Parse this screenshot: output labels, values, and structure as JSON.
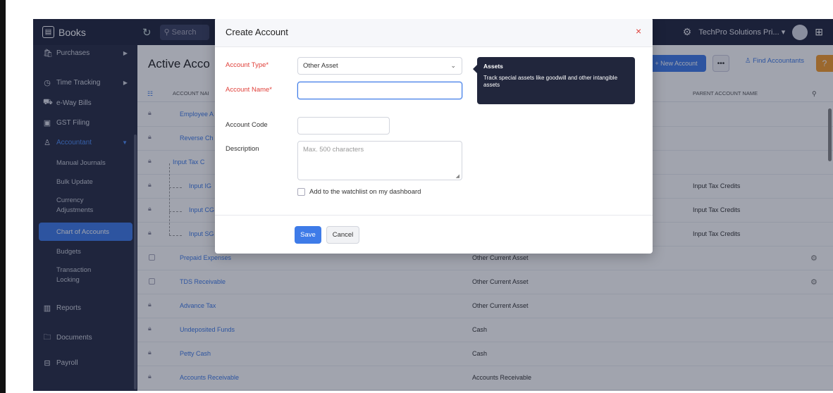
{
  "app": {
    "name": "Books",
    "search_placeholder": "Search",
    "org_name": "TechPro Solutions Pri...",
    "org_chevron": "▾"
  },
  "sidebar": {
    "items": [
      {
        "label": "Purchases",
        "icon": "bag-icon"
      },
      {
        "label": "Time Tracking",
        "icon": "clock-icon"
      },
      {
        "label": "e-Way Bills",
        "icon": "truck-icon"
      },
      {
        "label": "GST Filing",
        "icon": "filing-icon"
      },
      {
        "label": "Accountant",
        "icon": "accountant-icon"
      },
      {
        "label": "Reports",
        "icon": "chart-icon"
      },
      {
        "label": "Documents",
        "icon": "folder-icon"
      },
      {
        "label": "Payroll",
        "icon": "payroll-icon"
      }
    ],
    "sub_items": [
      "Manual Journals",
      "Bulk Update",
      "Currency Adjustments",
      "Chart of Accounts",
      "Budgets",
      "Transaction Locking"
    ],
    "collapse_label": "‹"
  },
  "main": {
    "title": "Active Acco",
    "new_button": "+ New Account",
    "more_button": "•••",
    "find_button": "Find Accountants",
    "columns": {
      "name": "ACCOUNT NAI",
      "parent": "PARENT ACCOUNT NAME"
    },
    "rows": [
      {
        "name": "Employee A",
        "type": "",
        "parent": ""
      },
      {
        "name": "Reverse Ch",
        "type": "",
        "parent": ""
      },
      {
        "name": "Input Tax C",
        "type": "",
        "parent": ""
      },
      {
        "name": "Input IG",
        "type": "",
        "parent": "Input Tax Credits"
      },
      {
        "name": "Input CG",
        "type": "",
        "parent": "Input Tax Credits"
      },
      {
        "name": "Input SG",
        "type": "",
        "parent": "Input Tax Credits"
      },
      {
        "name": "Prepaid Expenses",
        "type": "Other Current Asset",
        "parent": ""
      },
      {
        "name": "TDS Receivable",
        "type": "Other Current Asset",
        "parent": ""
      },
      {
        "name": "Advance Tax",
        "type": "Other Current Asset",
        "parent": ""
      },
      {
        "name": "Undeposited Funds",
        "type": "Cash",
        "parent": ""
      },
      {
        "name": "Petty Cash",
        "type": "Cash",
        "parent": ""
      },
      {
        "name": "Accounts Receivable",
        "type": "Accounts Receivable",
        "parent": ""
      }
    ]
  },
  "modal": {
    "title": "Create Account",
    "close": "×",
    "account_type_label": "Account Type*",
    "account_type_value": "Other Asset",
    "account_name_label": "Account Name*",
    "account_name_value": "",
    "account_code_label": "Account Code",
    "account_code_value": "",
    "description_label": "Description",
    "description_placeholder": "Max. 500 characters",
    "watchlist_label": "Add to the watchlist on my dashboard",
    "save_label": "Save",
    "cancel_label": "Cancel"
  },
  "tooltip": {
    "title": "Assets",
    "body": "Track special assets like goodwill and other intangible assets"
  },
  "colors": {
    "primary": "#3e7be8",
    "topbar": "#21263c",
    "sidebar": "#272c43",
    "required": "#e0403a",
    "orange": "#f59b2b"
  }
}
